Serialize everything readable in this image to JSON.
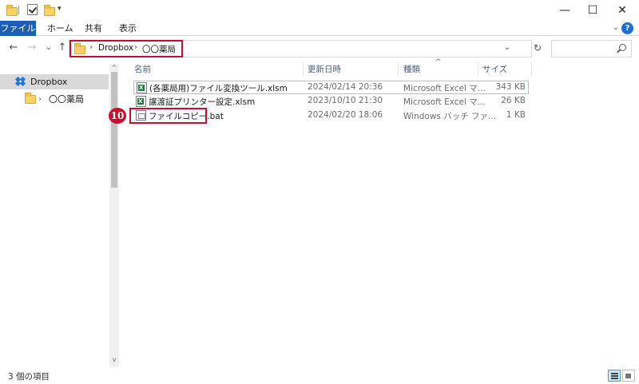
{
  "titlebar": {
    "minimize": "—",
    "maximize": "☐",
    "close": "✕",
    "qa_dropdown": "▾"
  },
  "ribbon": {
    "tabs": [
      "ファイル",
      "ホーム",
      "共有",
      "表示"
    ],
    "collapse": "⌄",
    "help": "?"
  },
  "nav": {
    "back": "←",
    "forward": "→",
    "recent": "⌄",
    "up": "↑"
  },
  "address": {
    "crumbs": [
      "Dropbox",
      "〇〇薬局"
    ],
    "separator": "›",
    "dropdown": "⌄",
    "refresh": "↻"
  },
  "search": {
    "placeholder": ""
  },
  "navpane": {
    "items": [
      {
        "label": "Dropbox",
        "selected": true
      },
      {
        "label": "〇〇薬局",
        "expander": "›"
      }
    ]
  },
  "columns": {
    "name": "名前",
    "date": "更新日時",
    "type": "種類",
    "size": "サイズ",
    "sort_indicator": "^"
  },
  "files": [
    {
      "name": "(各薬局用)ファイル変換ツール.xlsm",
      "date": "2024/02/14 20:36",
      "type": "Microsoft Excel マ...",
      "size": "343 KB",
      "icon": "excel-icon"
    },
    {
      "name": "譲渡証プリンター設定.xlsm",
      "date": "2023/10/10 21:30",
      "type": "Microsoft Excel マ...",
      "size": "26 KB",
      "icon": "excel-icon"
    },
    {
      "name": "ファイルコピー.bat",
      "date": "2024/02/20 18:06",
      "type": "Windows バッチ ファ...",
      "size": "1 KB",
      "icon": "batch-file-icon"
    }
  ],
  "annotation": {
    "step": "10",
    "color": "#c8102e"
  },
  "status": {
    "count": "3 個の項目"
  },
  "scroll": {
    "up": "^",
    "down": "v"
  },
  "colors": {
    "file_tab": "#1e5fb3",
    "highlight": "#c8102e",
    "selection": "#99c9ef"
  }
}
